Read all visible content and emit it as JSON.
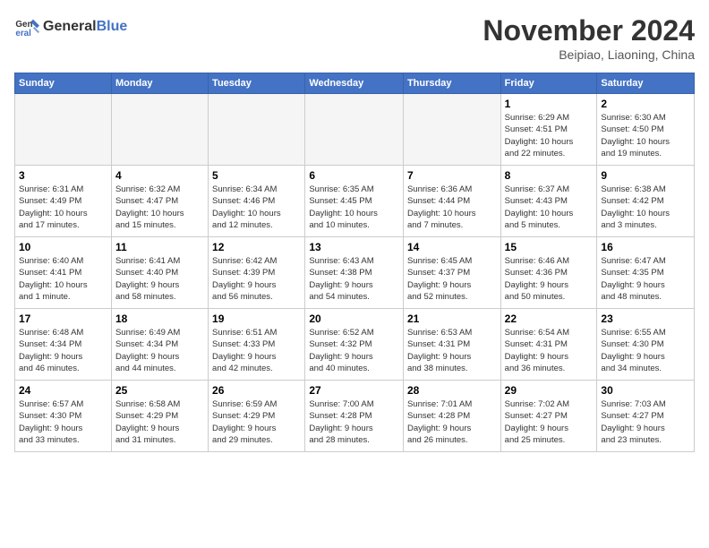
{
  "header": {
    "logo_line1": "General",
    "logo_line2": "Blue",
    "month": "November 2024",
    "location": "Beipiao, Liaoning, China"
  },
  "weekdays": [
    "Sunday",
    "Monday",
    "Tuesday",
    "Wednesday",
    "Thursday",
    "Friday",
    "Saturday"
  ],
  "weeks": [
    [
      {
        "day": "",
        "info": "",
        "empty": true
      },
      {
        "day": "",
        "info": "",
        "empty": true
      },
      {
        "day": "",
        "info": "",
        "empty": true
      },
      {
        "day": "",
        "info": "",
        "empty": true
      },
      {
        "day": "",
        "info": "",
        "empty": true
      },
      {
        "day": "1",
        "info": "Sunrise: 6:29 AM\nSunset: 4:51 PM\nDaylight: 10 hours\nand 22 minutes.",
        "empty": false
      },
      {
        "day": "2",
        "info": "Sunrise: 6:30 AM\nSunset: 4:50 PM\nDaylight: 10 hours\nand 19 minutes.",
        "empty": false
      }
    ],
    [
      {
        "day": "3",
        "info": "Sunrise: 6:31 AM\nSunset: 4:49 PM\nDaylight: 10 hours\nand 17 minutes.",
        "empty": false
      },
      {
        "day": "4",
        "info": "Sunrise: 6:32 AM\nSunset: 4:47 PM\nDaylight: 10 hours\nand 15 minutes.",
        "empty": false
      },
      {
        "day": "5",
        "info": "Sunrise: 6:34 AM\nSunset: 4:46 PM\nDaylight: 10 hours\nand 12 minutes.",
        "empty": false
      },
      {
        "day": "6",
        "info": "Sunrise: 6:35 AM\nSunset: 4:45 PM\nDaylight: 10 hours\nand 10 minutes.",
        "empty": false
      },
      {
        "day": "7",
        "info": "Sunrise: 6:36 AM\nSunset: 4:44 PM\nDaylight: 10 hours\nand 7 minutes.",
        "empty": false
      },
      {
        "day": "8",
        "info": "Sunrise: 6:37 AM\nSunset: 4:43 PM\nDaylight: 10 hours\nand 5 minutes.",
        "empty": false
      },
      {
        "day": "9",
        "info": "Sunrise: 6:38 AM\nSunset: 4:42 PM\nDaylight: 10 hours\nand 3 minutes.",
        "empty": false
      }
    ],
    [
      {
        "day": "10",
        "info": "Sunrise: 6:40 AM\nSunset: 4:41 PM\nDaylight: 10 hours\nand 1 minute.",
        "empty": false
      },
      {
        "day": "11",
        "info": "Sunrise: 6:41 AM\nSunset: 4:40 PM\nDaylight: 9 hours\nand 58 minutes.",
        "empty": false
      },
      {
        "day": "12",
        "info": "Sunrise: 6:42 AM\nSunset: 4:39 PM\nDaylight: 9 hours\nand 56 minutes.",
        "empty": false
      },
      {
        "day": "13",
        "info": "Sunrise: 6:43 AM\nSunset: 4:38 PM\nDaylight: 9 hours\nand 54 minutes.",
        "empty": false
      },
      {
        "day": "14",
        "info": "Sunrise: 6:45 AM\nSunset: 4:37 PM\nDaylight: 9 hours\nand 52 minutes.",
        "empty": false
      },
      {
        "day": "15",
        "info": "Sunrise: 6:46 AM\nSunset: 4:36 PM\nDaylight: 9 hours\nand 50 minutes.",
        "empty": false
      },
      {
        "day": "16",
        "info": "Sunrise: 6:47 AM\nSunset: 4:35 PM\nDaylight: 9 hours\nand 48 minutes.",
        "empty": false
      }
    ],
    [
      {
        "day": "17",
        "info": "Sunrise: 6:48 AM\nSunset: 4:34 PM\nDaylight: 9 hours\nand 46 minutes.",
        "empty": false
      },
      {
        "day": "18",
        "info": "Sunrise: 6:49 AM\nSunset: 4:34 PM\nDaylight: 9 hours\nand 44 minutes.",
        "empty": false
      },
      {
        "day": "19",
        "info": "Sunrise: 6:51 AM\nSunset: 4:33 PM\nDaylight: 9 hours\nand 42 minutes.",
        "empty": false
      },
      {
        "day": "20",
        "info": "Sunrise: 6:52 AM\nSunset: 4:32 PM\nDaylight: 9 hours\nand 40 minutes.",
        "empty": false
      },
      {
        "day": "21",
        "info": "Sunrise: 6:53 AM\nSunset: 4:31 PM\nDaylight: 9 hours\nand 38 minutes.",
        "empty": false
      },
      {
        "day": "22",
        "info": "Sunrise: 6:54 AM\nSunset: 4:31 PM\nDaylight: 9 hours\nand 36 minutes.",
        "empty": false
      },
      {
        "day": "23",
        "info": "Sunrise: 6:55 AM\nSunset: 4:30 PM\nDaylight: 9 hours\nand 34 minutes.",
        "empty": false
      }
    ],
    [
      {
        "day": "24",
        "info": "Sunrise: 6:57 AM\nSunset: 4:30 PM\nDaylight: 9 hours\nand 33 minutes.",
        "empty": false
      },
      {
        "day": "25",
        "info": "Sunrise: 6:58 AM\nSunset: 4:29 PM\nDaylight: 9 hours\nand 31 minutes.",
        "empty": false
      },
      {
        "day": "26",
        "info": "Sunrise: 6:59 AM\nSunset: 4:29 PM\nDaylight: 9 hours\nand 29 minutes.",
        "empty": false
      },
      {
        "day": "27",
        "info": "Sunrise: 7:00 AM\nSunset: 4:28 PM\nDaylight: 9 hours\nand 28 minutes.",
        "empty": false
      },
      {
        "day": "28",
        "info": "Sunrise: 7:01 AM\nSunset: 4:28 PM\nDaylight: 9 hours\nand 26 minutes.",
        "empty": false
      },
      {
        "day": "29",
        "info": "Sunrise: 7:02 AM\nSunset: 4:27 PM\nDaylight: 9 hours\nand 25 minutes.",
        "empty": false
      },
      {
        "day": "30",
        "info": "Sunrise: 7:03 AM\nSunset: 4:27 PM\nDaylight: 9 hours\nand 23 minutes.",
        "empty": false
      }
    ]
  ]
}
